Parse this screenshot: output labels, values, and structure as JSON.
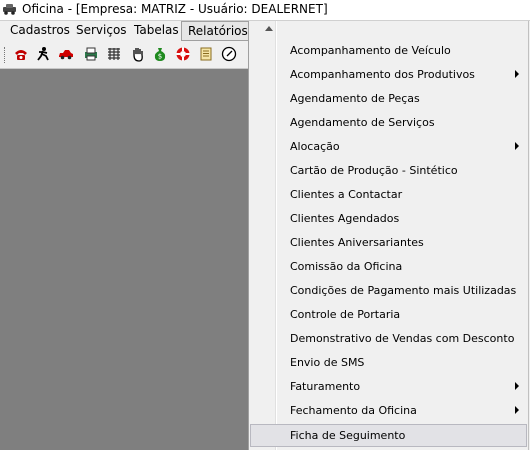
{
  "window": {
    "title": "Oficina - [Empresa: MATRIZ - Usuário: DEALERNET]",
    "icon": "car-icon"
  },
  "menubar": {
    "items": [
      "Cadastros",
      "Serviços",
      "Tabelas",
      "Relatórios"
    ],
    "active": "Relatórios"
  },
  "toolbar": {
    "buttons": [
      "phone-icon",
      "running-man-icon",
      "car-icon",
      "printer-icon",
      "calendar-grid-icon",
      "hand-icon",
      "money-bag-icon",
      "lifebuoy-icon",
      "document-icon",
      "clock-icon"
    ]
  },
  "dropdown": {
    "items": [
      {
        "label": "Acompanhamento de Veículo",
        "submenu": false
      },
      {
        "label": "Acompanhamento dos Produtivos",
        "submenu": true
      },
      {
        "label": "Agendamento de Peças",
        "submenu": false
      },
      {
        "label": "Agendamento de Serviços",
        "submenu": false
      },
      {
        "label": "Alocação",
        "submenu": true
      },
      {
        "label": "Cartão de Produção - Sintético",
        "submenu": false
      },
      {
        "label": "Clientes a Contactar",
        "submenu": false
      },
      {
        "label": "Clientes Agendados",
        "submenu": false
      },
      {
        "label": "Clientes Aniversariantes",
        "submenu": false
      },
      {
        "label": "Comissão da Oficina",
        "submenu": false
      },
      {
        "label": "Condições de Pagamento mais Utilizadas",
        "submenu": false
      },
      {
        "label": "Controle de Portaria",
        "submenu": false
      },
      {
        "label": "Demonstrativo de Vendas com Desconto",
        "submenu": false
      },
      {
        "label": "Envio de SMS",
        "submenu": false
      },
      {
        "label": "Faturamento",
        "submenu": true
      },
      {
        "label": "Fechamento da Oficina",
        "submenu": true
      },
      {
        "label": "Ficha de Seguimento",
        "submenu": false,
        "highlighted": true
      }
    ]
  }
}
